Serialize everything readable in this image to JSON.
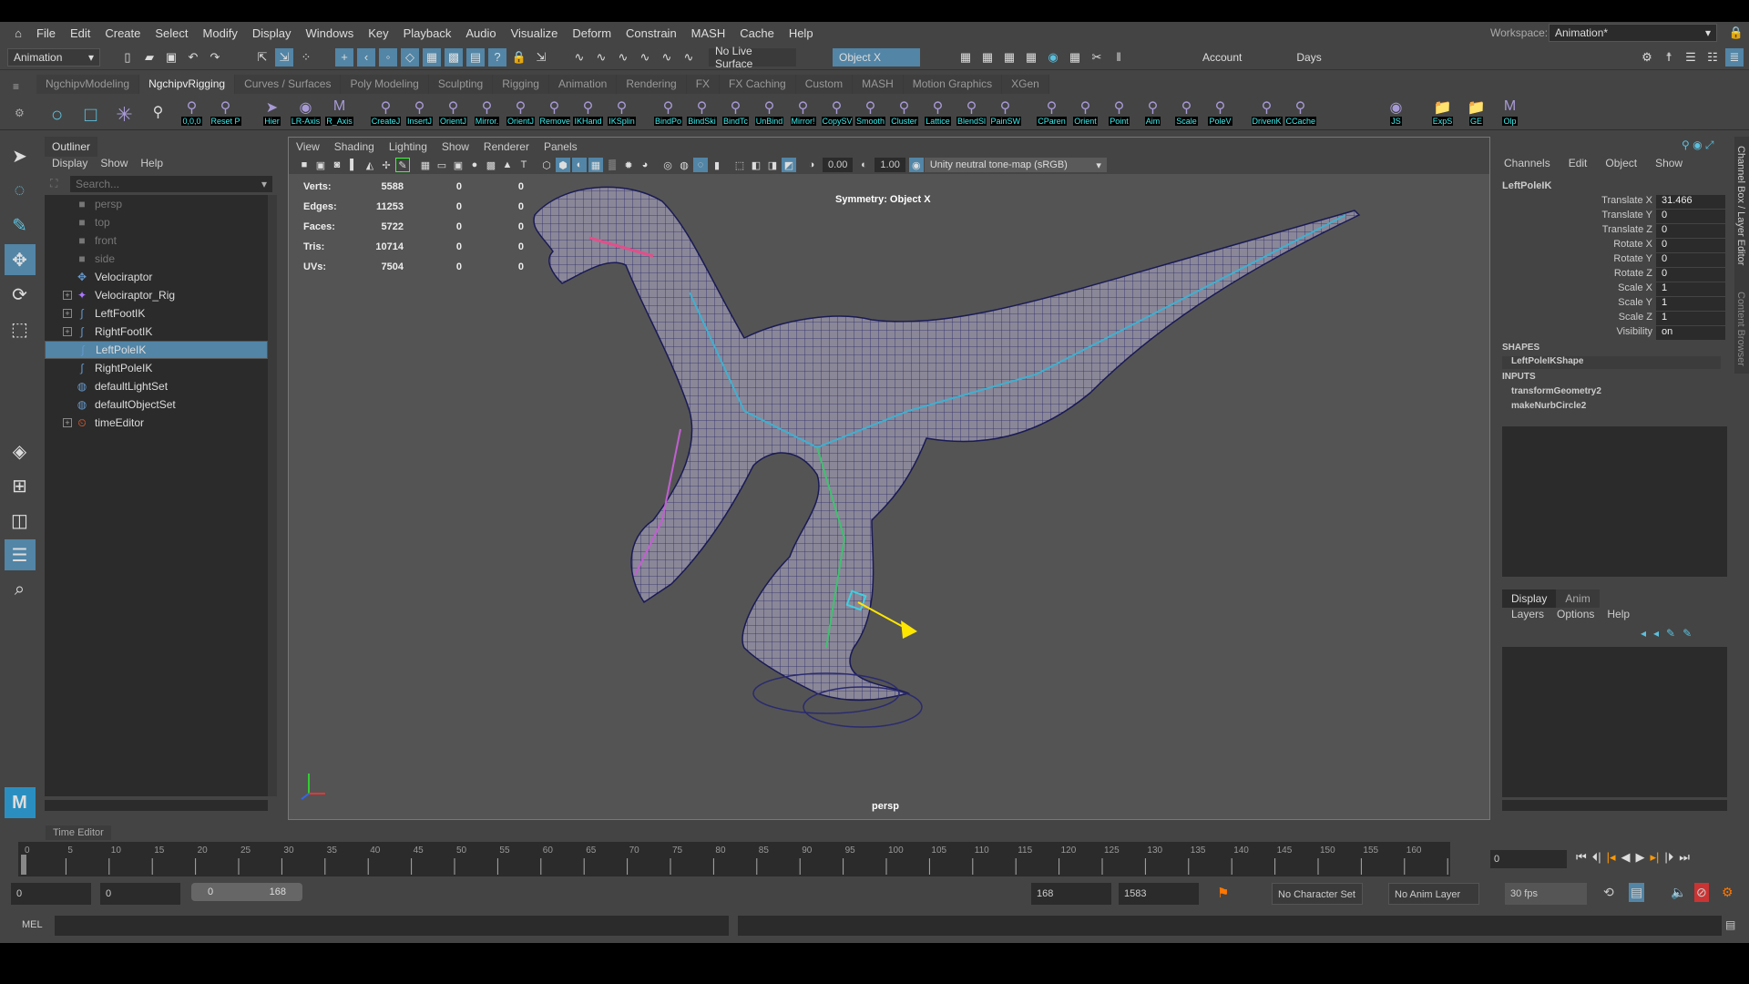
{
  "menubar": {
    "items": [
      "File",
      "Edit",
      "Create",
      "Select",
      "Modify",
      "Display",
      "Windows",
      "Key",
      "Playback",
      "Audio",
      "Visualize",
      "Deform",
      "Constrain",
      "MASH",
      "Cache",
      "Help"
    ],
    "workspace_label": "Workspace:",
    "workspace_value": "Animation*"
  },
  "statusline": {
    "menuset": "Animation",
    "live_surface": "No Live Surface",
    "symmetry": "Object X",
    "account": "Account",
    "days": "Days"
  },
  "shelf": {
    "tabs": [
      "NgchipvModeling",
      "NgchipvRigging",
      "Curves / Surfaces",
      "Poly Modeling",
      "Sculpting",
      "Rigging",
      "Animation",
      "Rendering",
      "FX",
      "FX Caching",
      "Custom",
      "MASH",
      "Motion Graphics",
      "XGen"
    ],
    "active_tab": "NgchipvRigging",
    "buttons": [
      "0,0,0",
      "Reset P",
      "Hier",
      "LR-Axis",
      "R_Axis",
      "CreateJ",
      "InsertJ",
      "OrientJ",
      "Mirror.",
      "OrientJ",
      "Remove",
      "IKHand",
      "IKSplin",
      "BindPo",
      "BindSki",
      "BindTc",
      "UnBind",
      "Mirror!",
      "CopySV",
      "Smooth",
      "Cluster",
      "Lattice",
      "BlendSl",
      "PainSW",
      "CParen",
      "Orient",
      "Point",
      "Aim",
      "Scale",
      "PoleV",
      "DrivenK",
      "CCache",
      "JS",
      "ExpS",
      "GE",
      "Olp"
    ]
  },
  "outliner": {
    "title": "Outliner",
    "menu": [
      "Display",
      "Show",
      "Help"
    ],
    "search_placeholder": "Search...",
    "items": [
      {
        "label": "persp",
        "icon": "camera-icon",
        "dim": true
      },
      {
        "label": "top",
        "icon": "camera-icon",
        "dim": true
      },
      {
        "label": "front",
        "icon": "camera-icon",
        "dim": true
      },
      {
        "label": "side",
        "icon": "camera-icon",
        "dim": true
      },
      {
        "label": "Velociraptor",
        "icon": "mesh-group-icon"
      },
      {
        "label": "Velociraptor_Rig",
        "icon": "joint-icon",
        "expand": true
      },
      {
        "label": "LeftFootIK",
        "icon": "curve-icon",
        "expand": true
      },
      {
        "label": "RightFootIK",
        "icon": "curve-icon",
        "expand": true
      },
      {
        "label": "LeftPoleIK",
        "icon": "curve-icon",
        "selected": true
      },
      {
        "label": "RightPoleIK",
        "icon": "curve-icon"
      },
      {
        "label": "defaultLightSet",
        "icon": "set-icon"
      },
      {
        "label": "defaultObjectSet",
        "icon": "set-icon"
      },
      {
        "label": "timeEditor",
        "icon": "time-editor-icon",
        "expand": true
      }
    ]
  },
  "viewport": {
    "menu": [
      "View",
      "Shading",
      "Lighting",
      "Show",
      "Renderer",
      "Panels"
    ],
    "exposure": "0.00",
    "gamma": "1.00",
    "colorspace": "Unity neutral tone-map (sRGB)",
    "hud": [
      {
        "label": "Verts:",
        "a": "5588",
        "b": "0",
        "c": "0"
      },
      {
        "label": "Edges:",
        "a": "11253",
        "b": "0",
        "c": "0"
      },
      {
        "label": "Faces:",
        "a": "5722",
        "b": "0",
        "c": "0"
      },
      {
        "label": "Tris:",
        "a": "10714",
        "b": "0",
        "c": "0"
      },
      {
        "label": "UVs:",
        "a": "7504",
        "b": "0",
        "c": "0"
      }
    ],
    "symmetry": "Symmetry: Object X",
    "camera": "persp"
  },
  "channelbox": {
    "menu": [
      "Channels",
      "Edit",
      "Object",
      "Show"
    ],
    "object": "LeftPoleIK",
    "attrs": [
      {
        "n": "Translate X",
        "v": "31.466"
      },
      {
        "n": "Translate Y",
        "v": "0"
      },
      {
        "n": "Translate Z",
        "v": "0"
      },
      {
        "n": "Rotate X",
        "v": "0"
      },
      {
        "n": "Rotate Y",
        "v": "0"
      },
      {
        "n": "Rotate Z",
        "v": "0"
      },
      {
        "n": "Scale X",
        "v": "1"
      },
      {
        "n": "Scale Y",
        "v": "1"
      },
      {
        "n": "Scale Z",
        "v": "1"
      },
      {
        "n": "Visibility",
        "v": "on"
      }
    ],
    "shapes_header": "SHAPES",
    "shape": "LeftPoleIKShape",
    "inputs_header": "INPUTS",
    "inputs": [
      "transformGeometry2",
      "makeNurbCircle2"
    ],
    "layer_tabs": [
      "Display",
      "Anim"
    ],
    "layer_menu": [
      "Layers",
      "Options",
      "Help"
    ],
    "side_tabs": [
      "Channel Box / Layer Editor",
      "Content Browser"
    ]
  },
  "timeline": {
    "label": "Time Editor",
    "start": 0,
    "end": 168,
    "current": "0",
    "tick_step": 5
  },
  "range": {
    "start": "0",
    "anim_start": "0",
    "slider_start": "0",
    "slider_end": "168",
    "end": "168",
    "anim_end": "1583",
    "character": "No Character Set",
    "anim_layer": "No Anim Layer",
    "fps": "30 fps"
  },
  "mel": {
    "label": "MEL"
  }
}
